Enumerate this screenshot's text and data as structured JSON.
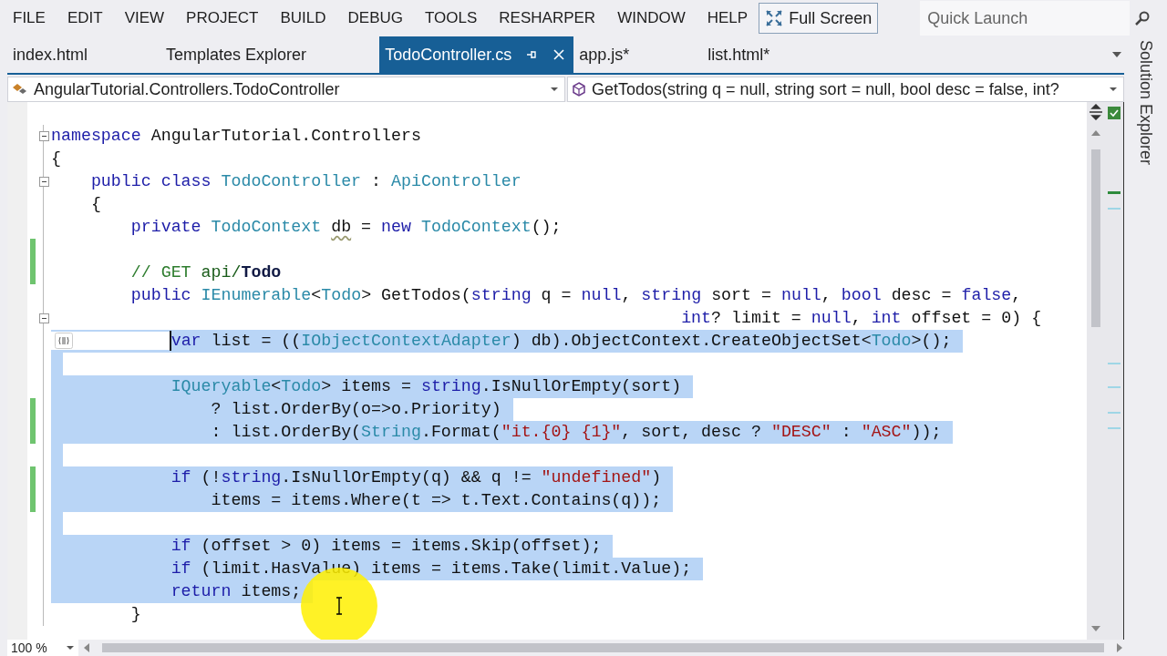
{
  "menu": [
    {
      "label": "FILE"
    },
    {
      "label": "EDIT"
    },
    {
      "label": "VIEW"
    },
    {
      "label": "PROJECT"
    },
    {
      "label": "BUILD"
    },
    {
      "label": "DEBUG"
    },
    {
      "label": "TOOLS"
    },
    {
      "label": "RESHARPER"
    },
    {
      "label": "WINDOW"
    },
    {
      "label": "HELP"
    }
  ],
  "full_screen": {
    "label": "Full Screen"
  },
  "quick_launch": {
    "placeholder": "Quick Launch"
  },
  "tabs": [
    {
      "label": "index.html",
      "selected": false
    },
    {
      "label": "Templates Explorer",
      "selected": false
    },
    {
      "label": "TodoController.cs",
      "selected": true
    },
    {
      "label": "app.js*",
      "selected": false
    },
    {
      "label": "list.html*",
      "selected": false
    }
  ],
  "navigation": {
    "type_dropdown": "AngularTutorial.Controllers.TodoController",
    "member_dropdown": "GetTodos(string q = null, string sort = null, bool desc = false, int?"
  },
  "editor": {
    "lines": [
      {
        "selected": false,
        "changed": false,
        "fold": true,
        "tokens": [
          {
            "kind": "kw",
            "text": "namespace"
          },
          {
            "kind": "plain",
            "text": " AngularTutorial.Controllers"
          }
        ]
      },
      {
        "selected": false,
        "changed": false,
        "fold": false,
        "tokens": [
          {
            "kind": "plain",
            "text": "{"
          }
        ]
      },
      {
        "selected": false,
        "changed": false,
        "fold": true,
        "tokens": [
          {
            "kind": "kw",
            "text": "    public class "
          },
          {
            "kind": "type",
            "text": "TodoController"
          },
          {
            "kind": "plain",
            "text": " : "
          },
          {
            "kind": "type",
            "text": "ApiController"
          }
        ]
      },
      {
        "selected": false,
        "changed": false,
        "fold": false,
        "tokens": [
          {
            "kind": "plain",
            "text": "    {"
          }
        ]
      },
      {
        "selected": false,
        "changed": false,
        "fold": false,
        "tokens": [
          {
            "kind": "kw",
            "text": "        private "
          },
          {
            "kind": "type",
            "text": "TodoContext "
          },
          {
            "kind": "plain",
            "text": "db",
            "warning": true
          },
          {
            "kind": "plain",
            "text": " = "
          },
          {
            "kind": "kw",
            "text": "new "
          },
          {
            "kind": "type",
            "text": "TodoContext"
          },
          {
            "kind": "plain",
            "text": "();"
          }
        ]
      },
      {
        "selected": false,
        "changed": true,
        "fold": false
      },
      {
        "selected": false,
        "changed": true,
        "fold": false,
        "tokens": [
          {
            "kind": "comment",
            "text": "        // GET "
          },
          {
            "kind": "comment-ref",
            "text": "api/"
          },
          {
            "kind": "comment-bold",
            "text": "Todo"
          }
        ]
      },
      {
        "selected": false,
        "changed": false,
        "fold": false,
        "tokens": [
          {
            "kind": "kw",
            "text": "        public "
          },
          {
            "kind": "type",
            "text": "IEnumerable"
          },
          {
            "kind": "plain",
            "text": "<"
          },
          {
            "kind": "type",
            "text": "Todo"
          },
          {
            "kind": "plain",
            "text": "> GetTodos("
          },
          {
            "kind": "kw",
            "text": "string"
          },
          {
            "kind": "plain",
            "text": " q = "
          },
          {
            "kind": "kw",
            "text": "null"
          },
          {
            "kind": "plain",
            "text": ", "
          },
          {
            "kind": "kw",
            "text": "string"
          },
          {
            "kind": "plain",
            "text": " sort = "
          },
          {
            "kind": "kw",
            "text": "null"
          },
          {
            "kind": "plain",
            "text": ", "
          },
          {
            "kind": "kw",
            "text": "bool"
          },
          {
            "kind": "plain",
            "text": " desc = "
          },
          {
            "kind": "kw",
            "text": "false"
          },
          {
            "kind": "plain",
            "text": ","
          }
        ]
      },
      {
        "selected": false,
        "changed": false,
        "fold": true,
        "tokens": [
          {
            "kind": "kw",
            "text": "                                                               int"
          },
          {
            "kind": "plain",
            "text": "? limit = "
          },
          {
            "kind": "kw",
            "text": "null"
          },
          {
            "kind": "plain",
            "text": ", "
          },
          {
            "kind": "kw",
            "text": "int"
          },
          {
            "kind": "plain",
            "text": " offset = 0) {"
          }
        ]
      },
      {
        "selected": true,
        "caret": true,
        "action_icon": true,
        "changed": false,
        "fold": false,
        "tokens": [
          {
            "kind": "kw",
            "text": "            var"
          },
          {
            "kind": "plain",
            "text": " list = (("
          },
          {
            "kind": "type",
            "text": "IObjectContextAdapter"
          },
          {
            "kind": "plain",
            "text": ") db).ObjectContext.CreateObjectSet<"
          },
          {
            "kind": "type",
            "text": "Todo"
          },
          {
            "kind": "plain",
            "text": ">();"
          }
        ]
      },
      {
        "selected": true,
        "changed": false,
        "fold": false
      },
      {
        "selected": true,
        "changed": false,
        "fold": false,
        "tokens": [
          {
            "kind": "type",
            "text": "            IQueryable"
          },
          {
            "kind": "plain",
            "text": "<"
          },
          {
            "kind": "type",
            "text": "Todo"
          },
          {
            "kind": "plain",
            "text": "> items = "
          },
          {
            "kind": "kw",
            "text": "string"
          },
          {
            "kind": "plain",
            "text": ".IsNullOrEmpty(sort)"
          }
        ]
      },
      {
        "selected": true,
        "changed": true,
        "fold": false,
        "tokens": [
          {
            "kind": "plain",
            "text": "                ? list.OrderBy(o=>o.Priority)"
          }
        ]
      },
      {
        "selected": true,
        "changed": true,
        "fold": false,
        "tokens": [
          {
            "kind": "plain",
            "text": "                : list.OrderBy("
          },
          {
            "kind": "type",
            "text": "String"
          },
          {
            "kind": "plain",
            "text": ".Format("
          },
          {
            "kind": "str",
            "text": "\"it.{0} {1}\""
          },
          {
            "kind": "plain",
            "text": ", sort, desc ? "
          },
          {
            "kind": "str",
            "text": "\"DESC\""
          },
          {
            "kind": "plain",
            "text": " : "
          },
          {
            "kind": "str",
            "text": "\"ASC\""
          },
          {
            "kind": "plain",
            "text": "));"
          }
        ]
      },
      {
        "selected": true,
        "changed": false,
        "fold": false
      },
      {
        "selected": true,
        "changed": true,
        "fold": false,
        "tokens": [
          {
            "kind": "kw",
            "text": "            if"
          },
          {
            "kind": "plain",
            "text": " (!"
          },
          {
            "kind": "kw",
            "text": "string"
          },
          {
            "kind": "plain",
            "text": ".IsNullOrEmpty(q) && q != "
          },
          {
            "kind": "str",
            "text": "\"undefined\""
          },
          {
            "kind": "plain",
            "text": ")"
          }
        ]
      },
      {
        "selected": true,
        "changed": true,
        "fold": false,
        "tokens": [
          {
            "kind": "plain",
            "text": "                items = items.Where(t => t.Text.Contains(q));"
          }
        ]
      },
      {
        "selected": true,
        "changed": false,
        "fold": false
      },
      {
        "selected": true,
        "changed": false,
        "fold": false,
        "tokens": [
          {
            "kind": "kw",
            "text": "            if"
          },
          {
            "kind": "plain",
            "text": " (offset > 0) items = items.Skip(offset);"
          }
        ]
      },
      {
        "selected": true,
        "changed": false,
        "fold": false,
        "tokens": [
          {
            "kind": "kw",
            "text": "            if"
          },
          {
            "kind": "plain",
            "text": " (limit.HasValue) items = items.Take(limit.Value);"
          }
        ]
      },
      {
        "selected": true,
        "changed": false,
        "fold": false,
        "tokens": [
          {
            "kind": "kw",
            "text": "            return"
          },
          {
            "kind": "plain",
            "text": " items;"
          }
        ]
      },
      {
        "selected": false,
        "changed": false,
        "fold": false,
        "tokens": [
          {
            "kind": "plain",
            "text": "        }"
          }
        ]
      }
    ]
  },
  "zoom": "100 %",
  "side_panel": {
    "title": "Solution Explorer"
  }
}
